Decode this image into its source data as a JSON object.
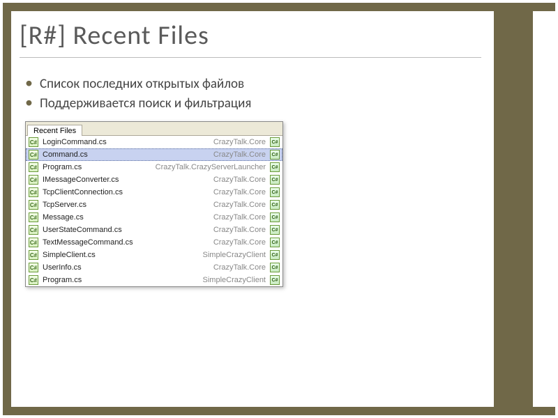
{
  "title": "[R#] Recent Files",
  "bullets": [
    "Список последних открытых файлов",
    "Поддерживается поиск и фильтрация"
  ],
  "popup": {
    "tab_label": "Recent Files",
    "selected_index": 1,
    "items": [
      {
        "name": "LoginCommand.cs",
        "project": "CrazyTalk.Core"
      },
      {
        "name": "Command.cs",
        "project": "CrazyTalk.Core"
      },
      {
        "name": "Program.cs",
        "project": "CrazyTalk.CrazyServerLauncher"
      },
      {
        "name": "IMessageConverter.cs",
        "project": "CrazyTalk.Core"
      },
      {
        "name": "TcpClientConnection.cs",
        "project": "CrazyTalk.Core"
      },
      {
        "name": "TcpServer.cs",
        "project": "CrazyTalk.Core"
      },
      {
        "name": "Message.cs",
        "project": "CrazyTalk.Core"
      },
      {
        "name": "UserStateCommand.cs",
        "project": "CrazyTalk.Core"
      },
      {
        "name": "TextMessageCommand.cs",
        "project": "CrazyTalk.Core"
      },
      {
        "name": "SimpleClient.cs",
        "project": "SimpleCrazyClient"
      },
      {
        "name": "UserInfo.cs",
        "project": "CrazyTalk.Core"
      },
      {
        "name": "Program.cs",
        "project": "SimpleCrazyClient"
      }
    ]
  }
}
